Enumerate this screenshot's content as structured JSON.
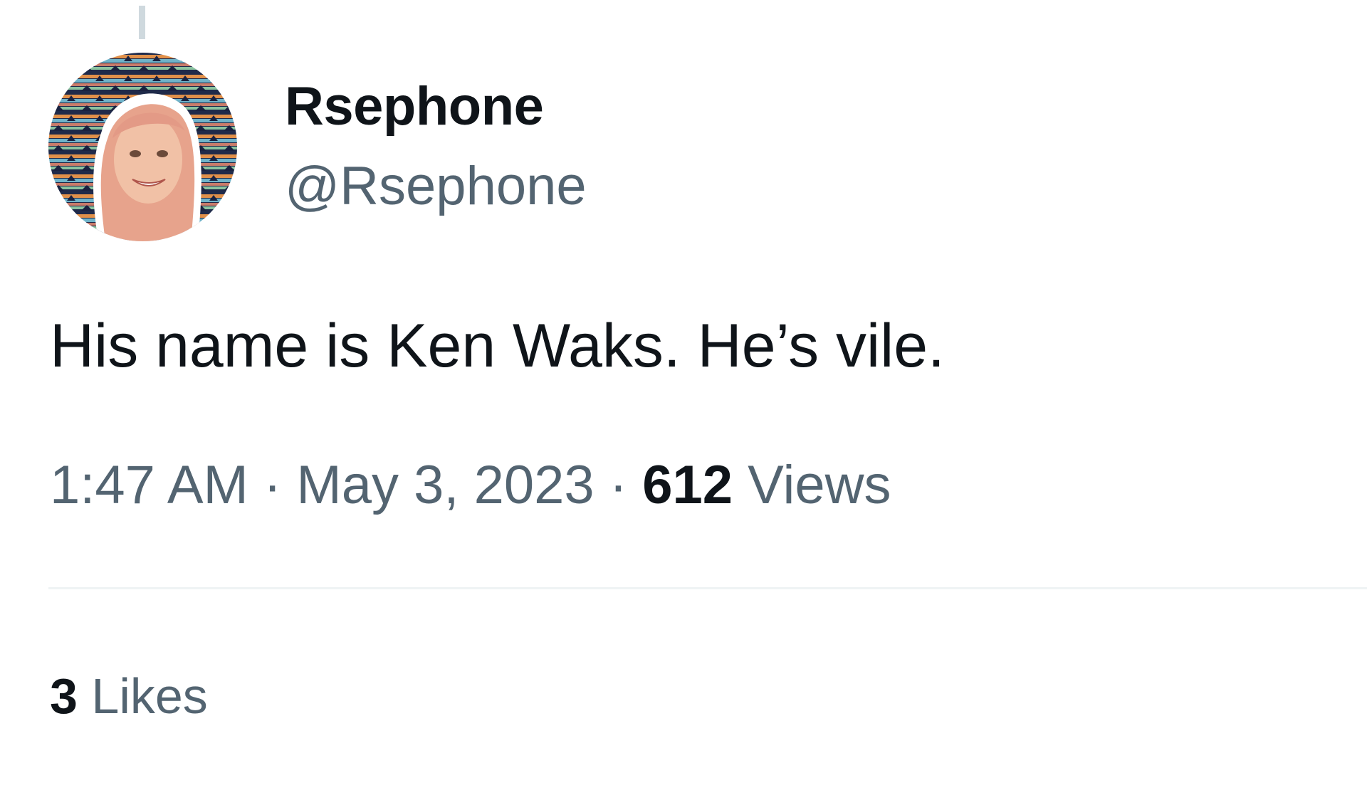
{
  "tweet": {
    "author": {
      "display_name": "Rsephone",
      "handle": "@Rsephone"
    },
    "text": "His name is Ken Waks. He’s vile.",
    "time": "1:47 AM",
    "separator": "·",
    "date": "May 3, 2023",
    "views_count": "612",
    "views_label": "Views",
    "likes_count": "3",
    "likes_label": "Likes"
  },
  "colors": {
    "primary_text": "#0f1419",
    "secondary_text": "#536471",
    "divider": "#eff3f4",
    "thread_line": "#cfd9de"
  }
}
